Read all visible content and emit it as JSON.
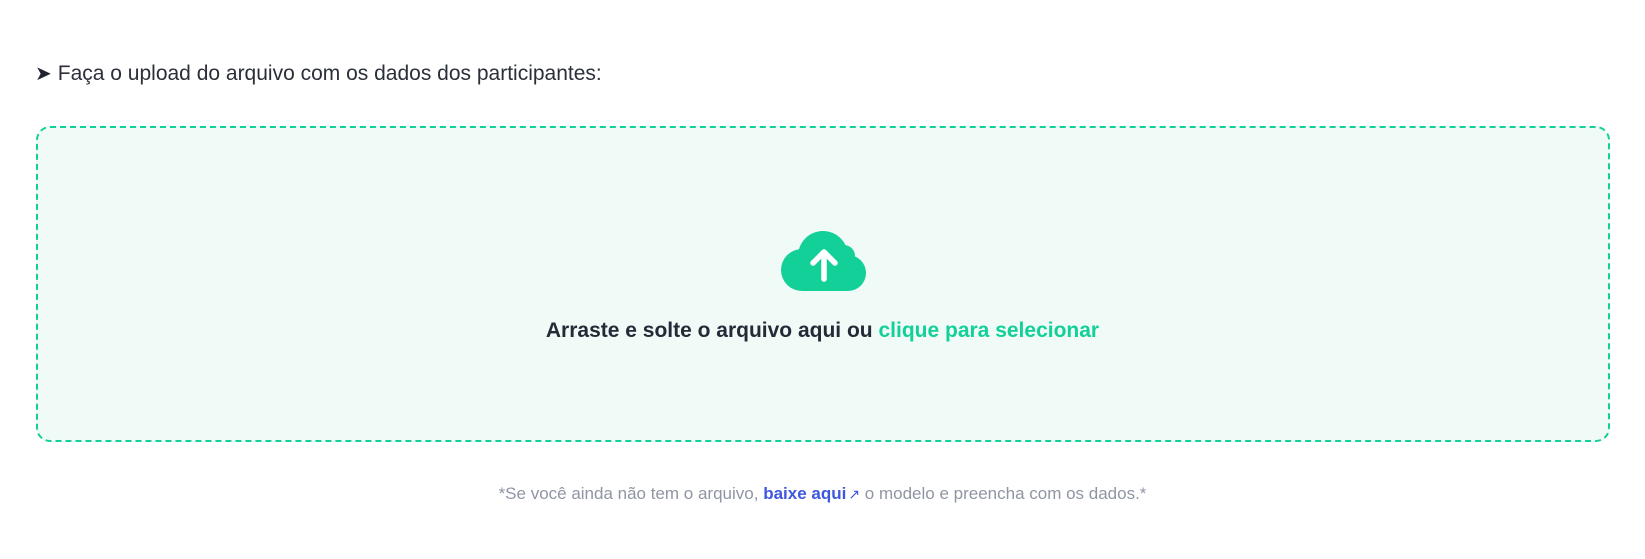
{
  "instruction": {
    "arrow_icon": "arrow-right-icon",
    "text": "Faça o upload do arquivo com os dados dos participantes:"
  },
  "dropzone": {
    "icon": "cloud-upload-icon",
    "prompt_text": "Arraste e solte o arquivo aqui ou",
    "select_link": "clique para selecionar",
    "accent_color": "#13cf98",
    "background_color": "#f0fbf8"
  },
  "footnote": {
    "prefix": "*Se você ainda não tem o arquivo,",
    "link_text": "baixe aqui",
    "link_icon": "external-link-icon",
    "suffix": "o modelo e preencha com os dados.*",
    "link_color": "#3f57df"
  }
}
